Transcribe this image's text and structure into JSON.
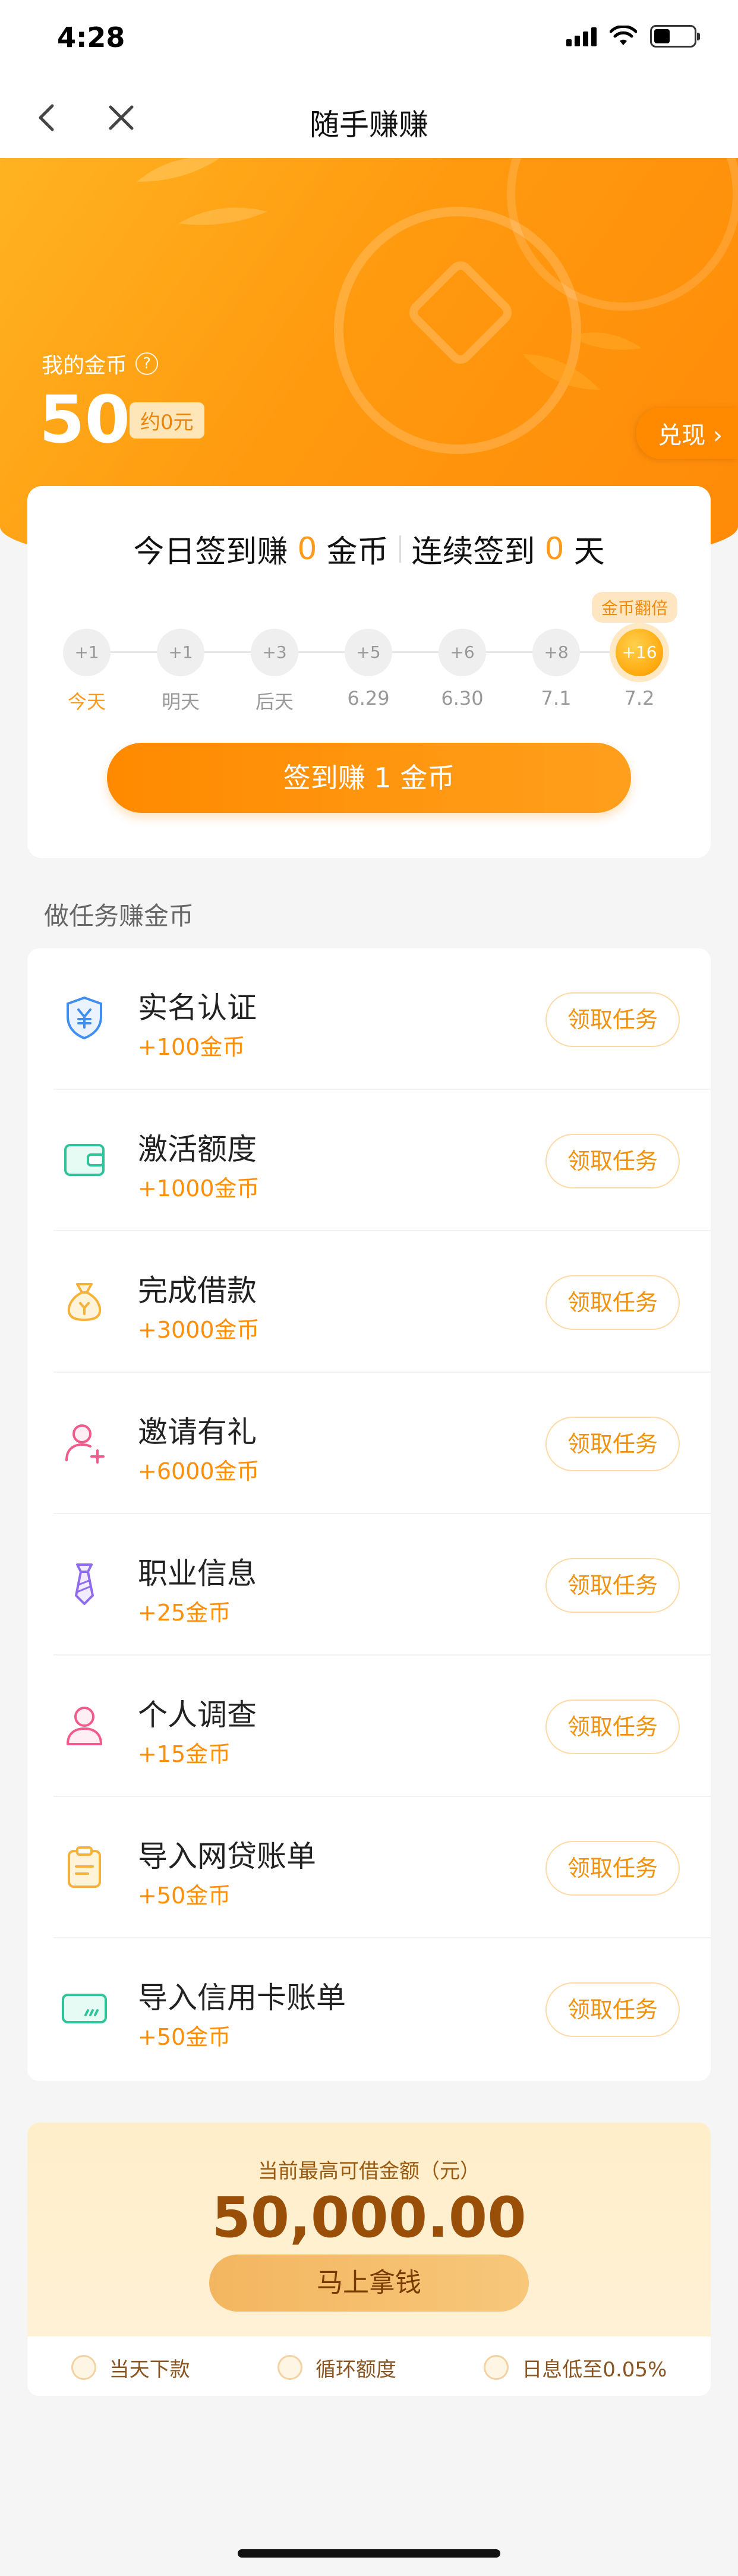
{
  "status": {
    "time": "4:28"
  },
  "nav": {
    "title": "随手赚赚"
  },
  "wallet": {
    "label": "我的金币",
    "help": "?",
    "coins": "50",
    "approx": "约0元",
    "exchange": "兑现 ›"
  },
  "signin": {
    "earn_prefix": "今日签到赚",
    "earn_value": "0",
    "earn_unit": "金币",
    "streak_prefix": "连续签到",
    "streak_value": "0",
    "streak_unit": "天",
    "double_tag": "金币翻倍",
    "days": [
      {
        "bonus": "+1",
        "label": "今天"
      },
      {
        "bonus": "+1",
        "label": "明天"
      },
      {
        "bonus": "+3",
        "label": "后天"
      },
      {
        "bonus": "+5",
        "label": "6.29"
      },
      {
        "bonus": "+6",
        "label": "6.30"
      },
      {
        "bonus": "+8",
        "label": "7.1"
      },
      {
        "bonus": "+16",
        "label": "7.2"
      }
    ],
    "button": "签到赚 1 金币"
  },
  "tasks_section": {
    "title": "做任务赚金币"
  },
  "tasks": [
    {
      "name": "实名认证",
      "reward": "+100金币",
      "button": "领取任务",
      "icon": "shield-yen-icon"
    },
    {
      "name": "激活额度",
      "reward": "+1000金币",
      "button": "领取任务",
      "icon": "wallet-icon"
    },
    {
      "name": "完成借款",
      "reward": "+3000金币",
      "button": "领取任务",
      "icon": "money-bag-icon"
    },
    {
      "name": "邀请有礼",
      "reward": "+6000金币",
      "button": "领取任务",
      "icon": "invite-user-icon"
    },
    {
      "name": "职业信息",
      "reward": "+25金币",
      "button": "领取任务",
      "icon": "tie-icon"
    },
    {
      "name": "个人调查",
      "reward": "+15金币",
      "button": "领取任务",
      "icon": "user-icon"
    },
    {
      "name": "导入网贷账单",
      "reward": "+50金币",
      "button": "领取任务",
      "icon": "clipboard-icon"
    },
    {
      "name": "导入信用卡账单",
      "reward": "+50金币",
      "button": "领取任务",
      "icon": "credit-card-icon"
    }
  ],
  "loan": {
    "label": "当前最高可借金额（元）",
    "amount": "50,000.00",
    "button": "马上拿钱",
    "features": [
      "当天下款",
      "循环额度",
      "日息低至0.05%"
    ]
  },
  "colors": {
    "accent": "#ff9a1a",
    "brand_orange": "#ff8a00",
    "loan_brown": "#9a4f08"
  }
}
